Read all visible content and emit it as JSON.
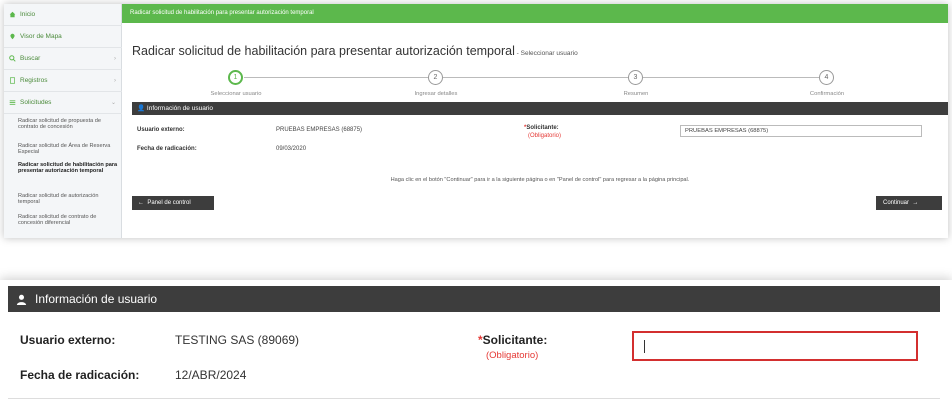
{
  "sidebar": {
    "items": [
      {
        "label": "Inicio",
        "icon": "home-icon"
      },
      {
        "label": "Visor de Mapa",
        "icon": "map-pin-icon"
      },
      {
        "label": "Buscar",
        "icon": "search-icon"
      },
      {
        "label": "Registros",
        "icon": "registry-icon"
      },
      {
        "label": "Solicitudes",
        "icon": "menu-icon"
      }
    ],
    "sub_items": [
      "Radicar solicitud de propuesta de contrato de concesión",
      "Radicar solicitud de Área de Reserva Especial",
      "Radicar solicitud de habilitación para presentar autorización temporal",
      "Radicar solicitud de autorización temporal",
      "Radicar solicitud de contrato de concesión diferencial"
    ]
  },
  "header": {
    "bar_text": "Radicar solicitud de habilitación para presentar autorización temporal",
    "title": "Radicar solicitud de habilitación para presentar autorización temporal",
    "subtitle": " - Seleccionar usuario"
  },
  "stepper": {
    "steps": [
      {
        "num": "1",
        "label": "Seleccionar usuario"
      },
      {
        "num": "2",
        "label": "Ingresar detalles"
      },
      {
        "num": "3",
        "label": "Resumen"
      },
      {
        "num": "4",
        "label": "Confirmación"
      }
    ]
  },
  "info_small": {
    "header": "Información de usuario",
    "usuario_label": "Usuario externo:",
    "usuario_value": "PRUEBAS EMPRESAS (68875)",
    "fecha_label": "Fecha de radicación:",
    "fecha_value": "09/03/2020",
    "solicitante_label": "Solicitante:",
    "obligatorio": "(Obligatorio)",
    "solicitante_value": "PRUEBAS EMPRESAS (68875)",
    "note": "Haga clic en el botón \"Continuar\" para ir a la siguiente página o en \"Panel de control\" para regresar a la página principal.",
    "back_button": "Panel de control",
    "continue_button": "Continuar"
  },
  "info_zoom": {
    "header": "Información de usuario",
    "usuario_label": "Usuario externo:",
    "usuario_value": "TESTING SAS (89069)",
    "fecha_label": "Fecha de radicación:",
    "fecha_value": "12/ABR/2024",
    "solicitante_label": "Solicitante:",
    "obligatorio": "(Obligatorio)",
    "solicitante_value": ""
  },
  "colors": {
    "green": "#5cb84c",
    "dark_header": "#3d3d3d",
    "required_red": "#e53935",
    "highlight_border": "#d32f2f"
  }
}
